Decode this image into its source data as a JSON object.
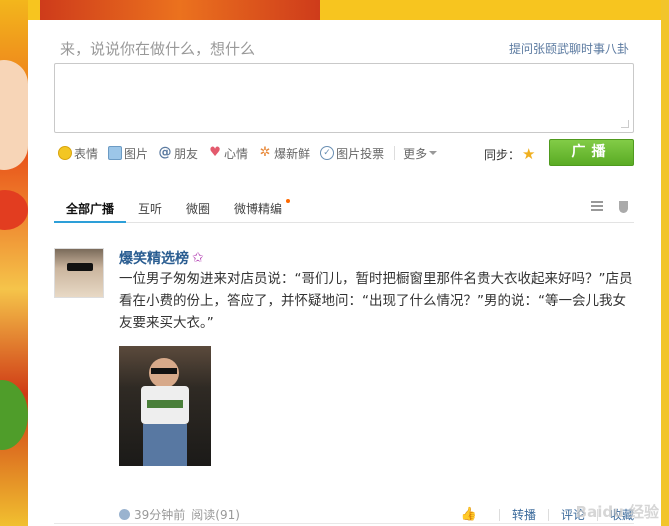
{
  "composer": {
    "placeholder": "来，说说你在做什么，想什么",
    "ask_link": "提问张颐武聊时事八卦"
  },
  "toolbar": {
    "items": [
      {
        "label": "表情",
        "icon": "emoji-icon"
      },
      {
        "label": "图片",
        "icon": "image-icon"
      },
      {
        "label": "朋友",
        "icon": "at-icon"
      },
      {
        "label": "心情",
        "icon": "heart-icon"
      },
      {
        "label": "爆新鲜",
        "icon": "burst-icon"
      },
      {
        "label": "图片投票",
        "icon": "check-icon"
      }
    ],
    "more_label": "更多",
    "sync_label": "同步：",
    "broadcast_label": "广播"
  },
  "tabs": {
    "items": [
      "全部广播",
      "互听",
      "微圈",
      "微博精编"
    ],
    "active": "全部广播"
  },
  "post": {
    "author": "爆笑精选榜",
    "text": "一位男子匆匆进来对店员说：“哥们儿，暂时把橱窗里那件名贵大衣收起来好吗？”店员看在小费的份上，答应了，并怀疑地问：“出现了什么情况？”男的说：“等一会儿我女友要来买大衣。”",
    "time": "39分钟前",
    "reads": "阅读(91)",
    "actions": {
      "repost": "转播",
      "comment": "评论",
      "favorite": "收藏"
    }
  },
  "watermark": "Baidu 经验",
  "colors": {
    "accent_green": "#5aab24",
    "link_blue": "#2a5d91",
    "tab_underline": "#2d9fd8"
  }
}
